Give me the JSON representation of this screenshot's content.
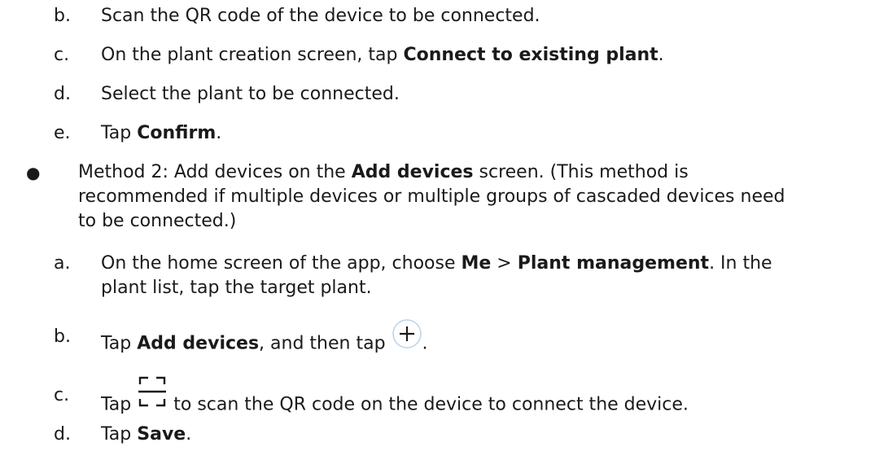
{
  "steps_top": [
    {
      "label": "b.",
      "parts": [
        "Scan the QR code of the device to be connected."
      ]
    },
    {
      "label": "c.",
      "parts": [
        "On the plant creation screen, tap ",
        "Connect to existing plant",
        "."
      ]
    },
    {
      "label": "d.",
      "parts": [
        "Select the plant to be connected."
      ]
    },
    {
      "label": "e.",
      "parts": [
        "Tap ",
        "Confirm",
        "."
      ]
    }
  ],
  "method2": {
    "bullet": "●",
    "lines": [
      [
        "Method 2: Add devices on the ",
        "Add devices",
        " screen. (This method is"
      ],
      [
        "recommended if multiple devices or multiple groups of cascaded devices need"
      ],
      [
        "to be connected.)"
      ]
    ]
  },
  "steps_bottom": {
    "a": {
      "label": "a.",
      "line1": [
        "On the home screen of the app, choose ",
        "Me",
        " > ",
        "Plant management",
        ". In the"
      ],
      "line2": "plant list, tap the target plant."
    },
    "b": {
      "label": "b.",
      "parts": [
        "Tap ",
        "Add devices",
        ", and then tap ",
        "."
      ],
      "icon": "add-circle-icon"
    },
    "c": {
      "label": "c.",
      "parts": [
        "Tap ",
        " to scan the QR code on the device to connect the device."
      ],
      "icon": "scan-icon"
    },
    "d": {
      "label": "d.",
      "parts": [
        "Tap ",
        "Save",
        "."
      ]
    }
  }
}
